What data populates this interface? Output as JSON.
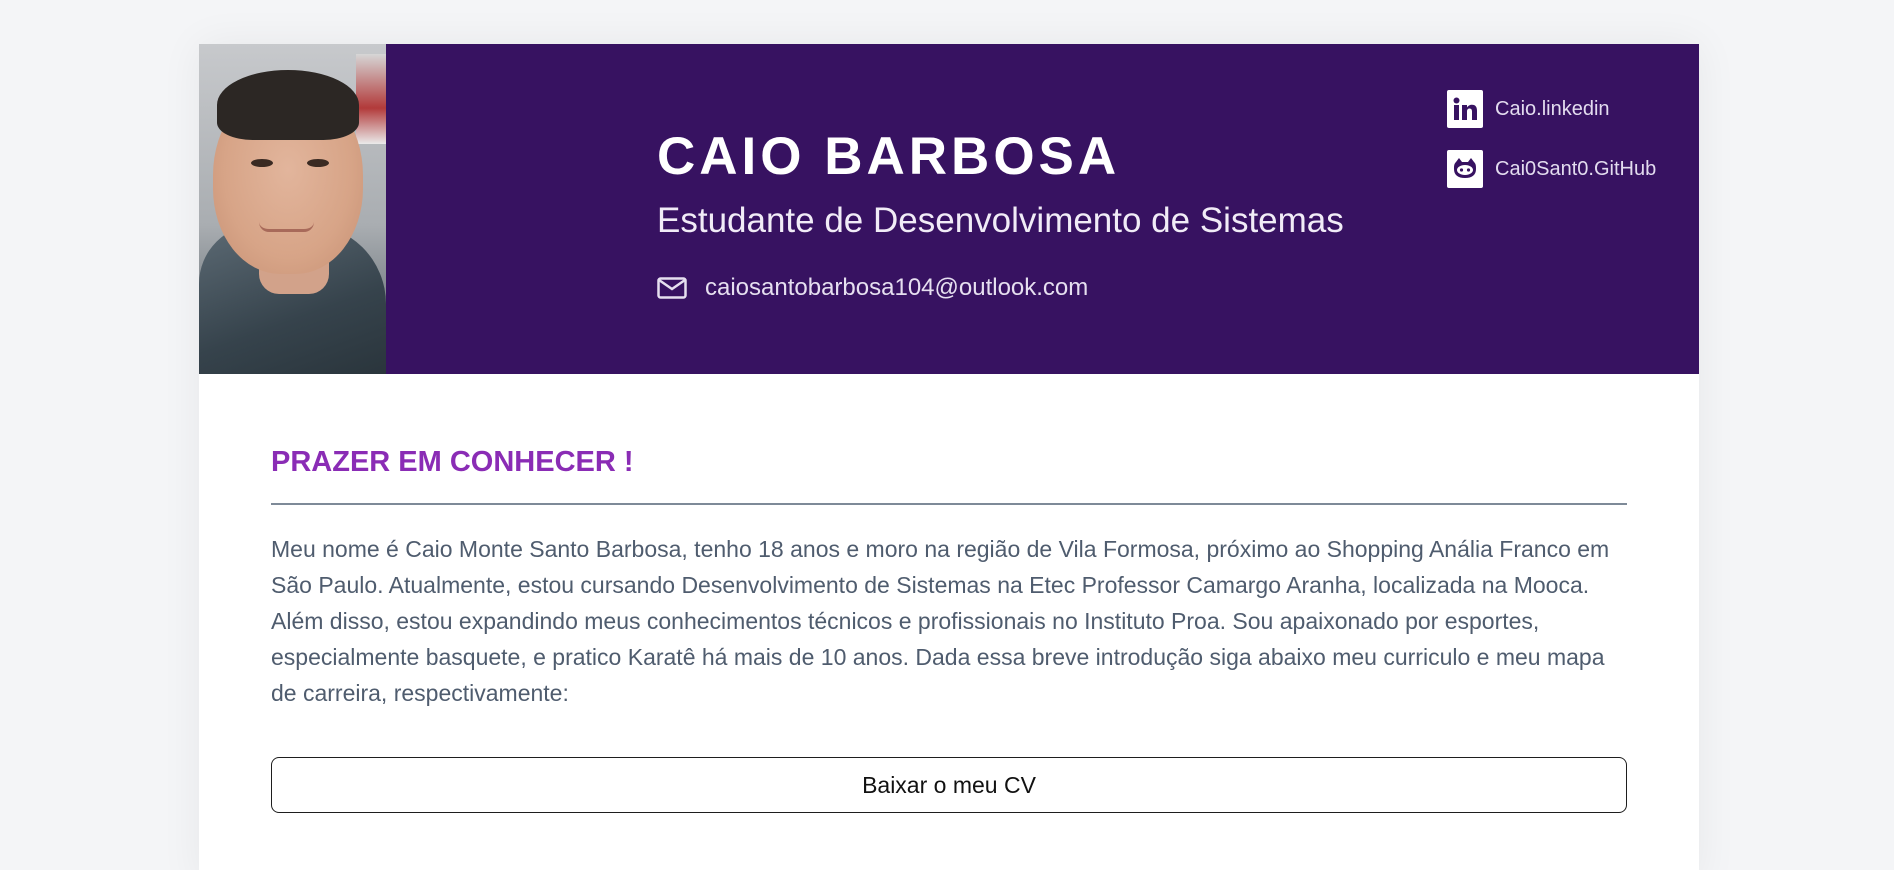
{
  "header": {
    "name": "CAIO BARBOSA",
    "subtitle": "Estudante de Desenvolvimento de Sistemas",
    "email": "caiosantobarbosa104@outlook.com",
    "email_icon": "envelope-icon"
  },
  "social": {
    "items": [
      {
        "label": "Caio.linkedin",
        "icon": "linkedin-icon"
      },
      {
        "label": "Cai0Sant0.GitHub",
        "icon": "github-icon"
      }
    ]
  },
  "about": {
    "title": "PRAZER EM CONHECER !",
    "text": "Meu nome é Caio Monte Santo Barbosa, tenho 18 anos e moro na região de Vila Formosa, próximo ao Shopping Anália Franco em São Paulo. Atualmente, estou cursando Desenvolvimento de Sistemas na Etec Professor Camargo Aranha, localizada na Mooca. Além disso, estou expandindo meus conhecimentos técnicos e profissionais no Instituto Proa. Sou apaixonado por esportes, especialmente basquete, e pratico Karatê há mais de 10 anos. Dada essa breve introdução siga abaixo meu curriculo e meu mapa de carreira, respectivamente:",
    "button_label": "Baixar o meu CV"
  },
  "colors": {
    "header_bg": "#371261",
    "title_accent": "#8a2cb5",
    "body_text": "#4f5c6e",
    "page_bg": "#f4f5f7"
  }
}
